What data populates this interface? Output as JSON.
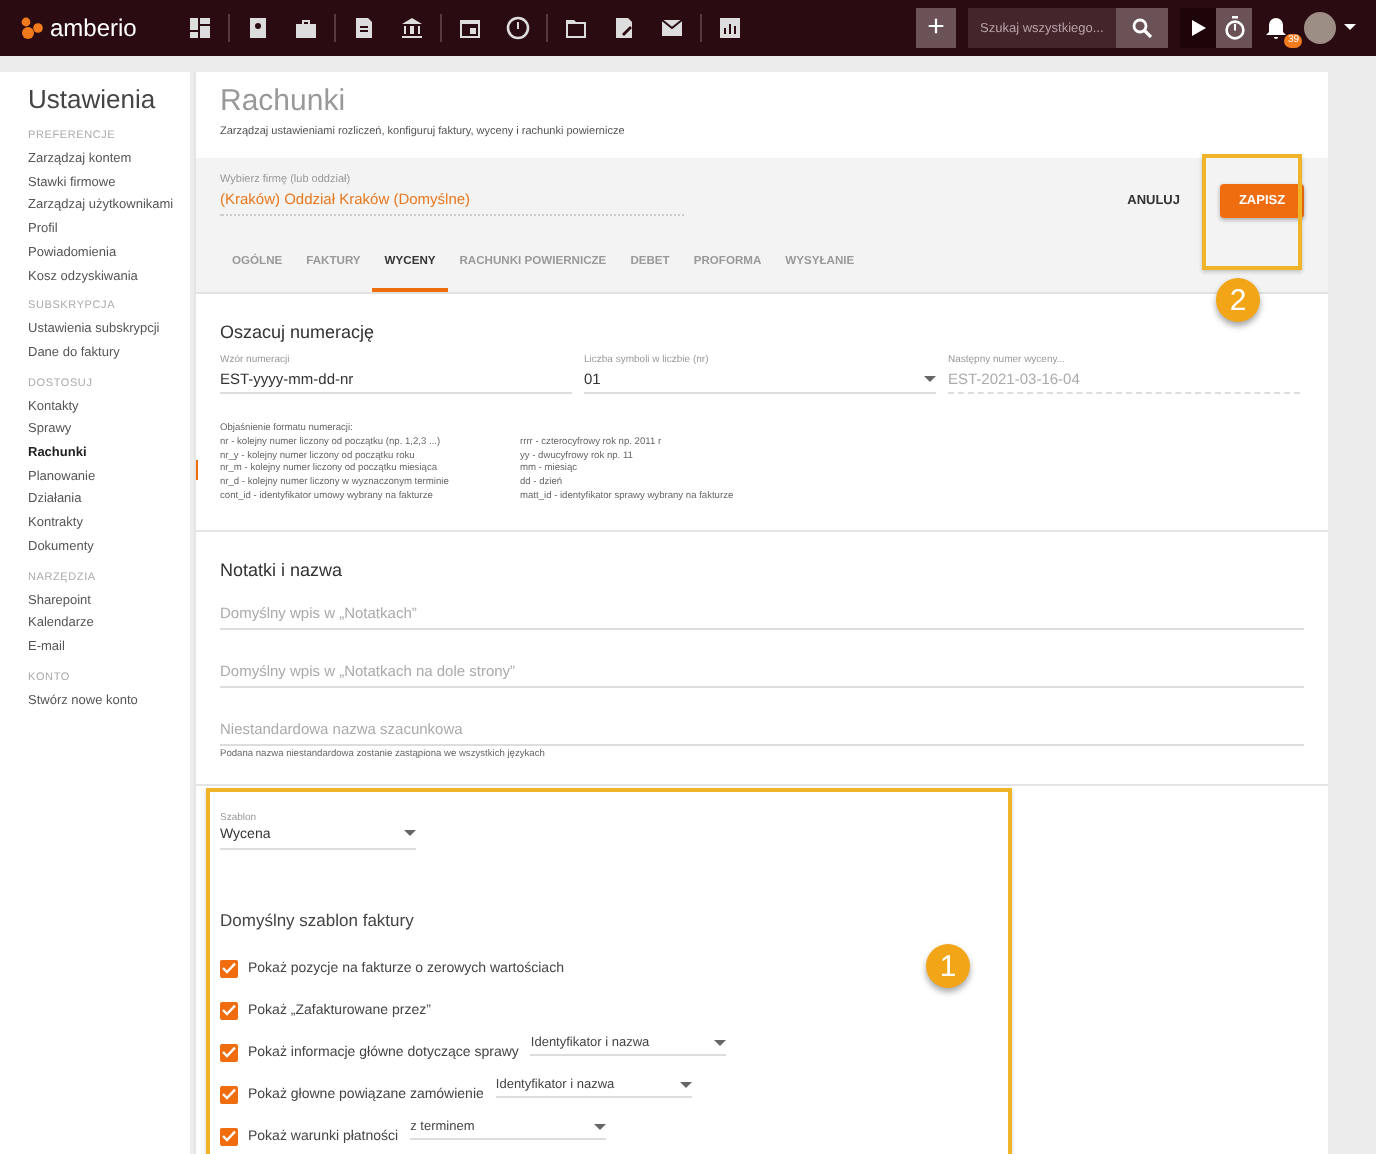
{
  "topbar": {
    "logo": "amberio",
    "add_button": "+",
    "search": {
      "placeholder": "Szukaj wszystkiego..."
    },
    "notification_count": "39"
  },
  "sidebar": {
    "title": "Ustawienia",
    "sections": [
      {
        "heading": "PREFERENCJE",
        "items": [
          {
            "label": "Zarządzaj kontem",
            "selected": false
          },
          {
            "label": "Stawki firmowe",
            "selected": false
          },
          {
            "label": "Zarządzaj użytkownikami",
            "selected": false
          },
          {
            "label": "Profil",
            "selected": false
          },
          {
            "label": "Powiadomienia",
            "selected": false
          },
          {
            "label": "Kosz odzyskiwania",
            "selected": false
          }
        ]
      },
      {
        "heading": "SUBSKRYPCJA",
        "items": [
          {
            "label": "Ustawienia subskrypcji",
            "selected": false
          },
          {
            "label": "Dane do faktury",
            "selected": false
          }
        ]
      },
      {
        "heading": "DOSTOSUJ",
        "items": [
          {
            "label": "Kontakty",
            "selected": false
          },
          {
            "label": "Sprawy",
            "selected": false
          },
          {
            "label": "Rachunki",
            "selected": true
          },
          {
            "label": "Planowanie",
            "selected": false
          },
          {
            "label": "Działania",
            "selected": false
          },
          {
            "label": "Kontrakty",
            "selected": false
          },
          {
            "label": "Dokumenty",
            "selected": false
          }
        ]
      },
      {
        "heading": "NARZĘDZIA",
        "items": [
          {
            "label": "Sharepoint",
            "selected": false
          },
          {
            "label": "Kalendarze",
            "selected": false
          },
          {
            "label": "E-mail",
            "selected": false
          }
        ]
      },
      {
        "heading": "KONTO",
        "items": [
          {
            "label": "Stwórz nowe konto",
            "selected": false
          }
        ]
      }
    ]
  },
  "page": {
    "title": "Rachunki",
    "subtitle": "Zarządzaj ustawieniami rozliczeń, konfiguruj faktury, wyceny i rachunki powiernicze",
    "company": {
      "label": "Wybierz firmę (lub oddział)",
      "value": "(Kraków) Oddział Kraków (Domyślne)"
    },
    "buttons": [
      {
        "label": "ANULUJ",
        "kind": "flat"
      },
      {
        "label": "ZAPISZ",
        "kind": "primary"
      }
    ],
    "tabs": [
      {
        "label": "OGÓLNE",
        "selected": false
      },
      {
        "label": "FAKTURY",
        "selected": false
      },
      {
        "label": "WYCENY",
        "selected": true
      },
      {
        "label": "RACHUNKI POWIERNICZE",
        "selected": false
      },
      {
        "label": "DEBET",
        "selected": false
      },
      {
        "label": "PROFORMA",
        "selected": false
      },
      {
        "label": "WYSYŁANIE",
        "selected": false
      }
    ]
  },
  "numbering": {
    "title": "Oszacuj numerację",
    "fields": [
      {
        "label": "Wzór numeracji",
        "value": "EST-yyyy-mm-dd-nr",
        "kind": "text"
      },
      {
        "label": "Liczba symboli w liczbie (nr)",
        "value": "01",
        "kind": "select"
      },
      {
        "label": "Następny numer wyceny...",
        "value": "EST-2021-03-16-04",
        "kind": "readonly"
      }
    ],
    "legend_title": "Objaśnienie formatu numeracji:",
    "legend": [
      [
        "nr - kolejny numer liczony od początku (np. 1,2,3 ...)",
        "rrrr - czterocyfrowy rok np. 2011 r"
      ],
      [
        "nr_y - kolejny numer liczony od początku roku",
        "yy - dwucyfrowy rok np. 11"
      ],
      [
        "nr_m - kolejny numer liczony od początku miesiąca",
        "mm - miesiąc"
      ],
      [
        "nr_d - kolejny numer liczony w wyznaczonym terminie",
        "dd - dzień"
      ],
      [
        "cont_id - identyfikator umowy wybrany na fakturze",
        "matt_id - identyfikator sprawy wybrany na fakturze"
      ]
    ]
  },
  "notes": {
    "title": "Notatki i nazwa",
    "fields": [
      {
        "placeholder": "Domyślny wpis w „Notatkach”"
      },
      {
        "placeholder": "Domyślny wpis w „Notatkach na dole strony”"
      },
      {
        "placeholder": "Niestandardowa nazwa szacunkowa"
      }
    ],
    "hint": "Podana nazwa niestandardowa zostanie zastąpiona we wszystkich językach"
  },
  "template": {
    "label": "Szablon",
    "value": "Wycena",
    "heading": "Domyślny szablon faktury",
    "options": [
      {
        "label": "Pokaż pozycje na fakturze o zerowych wartościach",
        "checked": true,
        "kind": "plain"
      },
      {
        "label": "Pokaż „Zafakturowane przez”",
        "checked": true,
        "kind": "plain"
      },
      {
        "label": "Pokaż informacje główne dotyczące sprawy",
        "checked": true,
        "kind": "with_select",
        "select": "Identyfikator i nazwa"
      },
      {
        "label": "Pokaż głowne powiązane zamówienie",
        "checked": true,
        "kind": "with_select",
        "select": "Identyfikator i nazwa"
      },
      {
        "label": "Pokaż warunki płatności",
        "checked": true,
        "kind": "with_select",
        "select": "z terminem"
      }
    ]
  },
  "annotations": [
    {
      "label": "1"
    },
    {
      "label": "2"
    }
  ]
}
